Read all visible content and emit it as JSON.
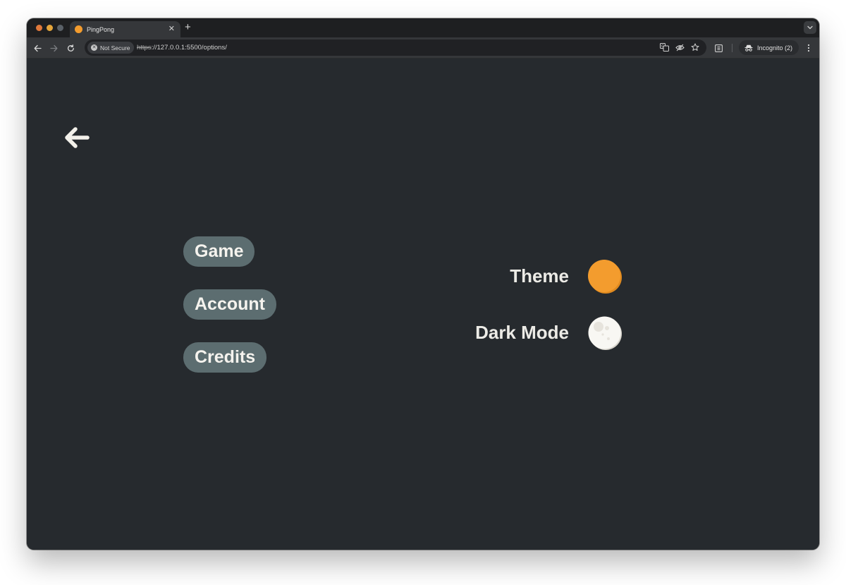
{
  "browser": {
    "tab": {
      "title": "PingPong",
      "favicon_color": "#f39c2e"
    },
    "address_bar": {
      "security_chip": "Not Secure",
      "url_scheme": "https",
      "url_rest": "://127.0.0.1:5500/options/"
    },
    "profile": {
      "label": "Incognito (2)"
    }
  },
  "page": {
    "back_icon": "arrow-left-icon",
    "menu": [
      {
        "label": "Game"
      },
      {
        "label": "Account"
      },
      {
        "label": "Credits"
      }
    ],
    "options": {
      "theme": {
        "label": "Theme",
        "color": "#f39c2e"
      },
      "dark_mode": {
        "label": "Dark Mode",
        "icon": "moon-icon"
      }
    }
  },
  "colors": {
    "background": "#262a2e",
    "menu_button": "#5c6d70",
    "text": "#ecebe6",
    "accent": "#f39c2e"
  }
}
